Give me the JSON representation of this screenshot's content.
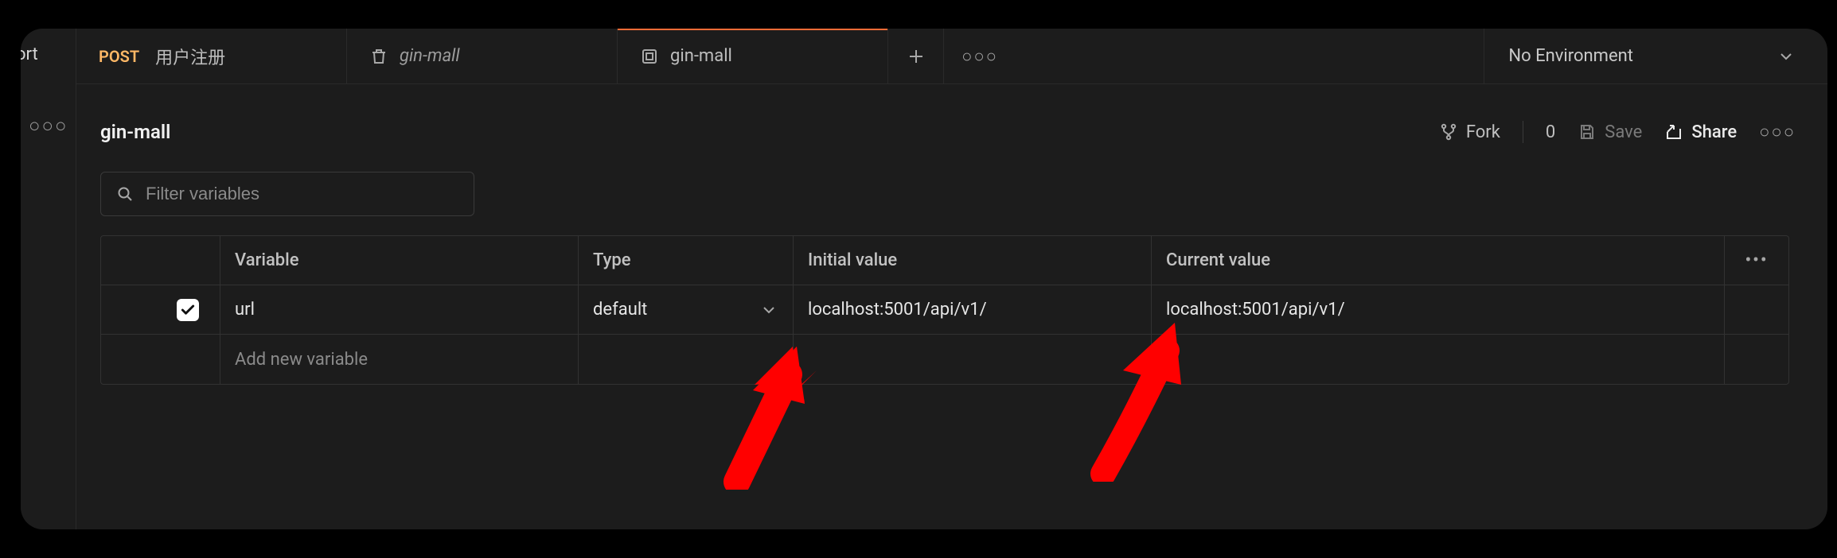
{
  "sidebar": {
    "sliver_label": "ort"
  },
  "tabs": [
    {
      "method": "POST",
      "label": "用户注册",
      "active": false,
      "icon": "request"
    },
    {
      "label": "gin-mall",
      "active": false,
      "icon": "trash",
      "italic": true
    },
    {
      "label": "gin-mall",
      "active": true,
      "icon": "environment"
    }
  ],
  "env_selector": {
    "label": "No Environment"
  },
  "page": {
    "title": "gin-mall"
  },
  "header_actions": {
    "fork_label": "Fork",
    "fork_count": "0",
    "save_label": "Save",
    "share_label": "Share"
  },
  "filter": {
    "placeholder": "Filter variables"
  },
  "var_table": {
    "headers": {
      "variable": "Variable",
      "type": "Type",
      "initial": "Initial value",
      "current": "Current value"
    },
    "rows": [
      {
        "checked": true,
        "variable": "url",
        "type": "default",
        "initial": "localhost:5001/api/v1/",
        "current": "localhost:5001/api/v1/"
      }
    ],
    "add_placeholder": "Add new variable"
  },
  "colors": {
    "accent_orange": "#ff6c37",
    "method_post": "#ffb866",
    "arrow_red": "#ff0000"
  }
}
